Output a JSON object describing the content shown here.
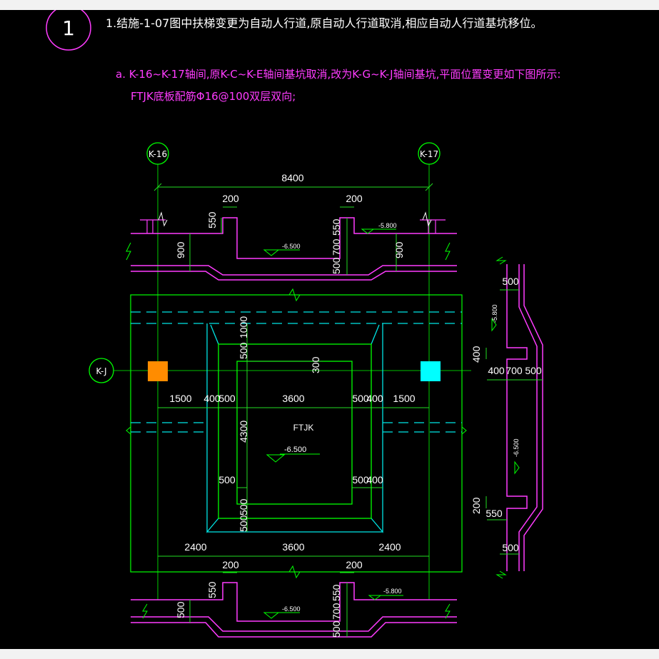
{
  "marker": {
    "number": "1"
  },
  "notes": {
    "main": "1.结施-1-07图中扶梯变更为自动人行道,原自动人行道取消,相应自动人行道基坑移位。",
    "item_a": "a. K-16~K-17轴间,原K-C~K-E轴间基坑取消,改为K-G~K-J轴间基坑,平面位置变更如下图所示:",
    "item_a2": "FTJK底板配筋Φ16@100双层双向;"
  },
  "axes": {
    "left": "K-16",
    "right": "K-17",
    "row": "K-J"
  },
  "plan": {
    "pit_label": "FTJK",
    "pit_level": "-6.500",
    "dim_total": "8400",
    "dims_inner_row": [
      "1500",
      "400",
      "500",
      "3600",
      "500",
      "400",
      "1500"
    ],
    "dims_bottom_row": [
      "2400",
      "3600",
      "2400"
    ],
    "dim_height": "4300",
    "dim_vertical_top": [
      "1000",
      "500",
      "300"
    ],
    "dim_vertical_bottom": [
      "500",
      "500"
    ],
    "dim_inner_small": [
      "500",
      "500",
      "400"
    ]
  },
  "section_top": {
    "dims_horizontal": [
      "200",
      "200"
    ],
    "dims_vertical_left": [
      "550",
      "900"
    ],
    "dims_vertical_mid": [
      "550",
      "700",
      "500"
    ],
    "dims_vertical_right": [
      "900"
    ],
    "level_pit": "-6.500",
    "level_side": "-5.800"
  },
  "section_bottom": {
    "dims_horizontal": [
      "200",
      "200"
    ],
    "dims_vertical_left": [
      "550",
      "500"
    ],
    "dims_vertical_mid": [
      "550",
      "700",
      "500"
    ],
    "level_pit": "-6.500",
    "level_side": "-5.800"
  },
  "section_side": {
    "dims_top": [
      "500"
    ],
    "dims_mid": [
      "400",
      "400",
      "700",
      "500"
    ],
    "dims_lower": [
      "200",
      "550"
    ],
    "dims_bottom": [
      "500"
    ],
    "level_top": "-5.800",
    "level_mid": "-6.500"
  },
  "colors": {
    "background": "#000000",
    "structure_green": "#00ff00",
    "section_magenta": "#ff3cff",
    "hidden_cyan": "#00e5e5",
    "dimension_green": "#22dd22",
    "text_white": "#ffffff",
    "column_orange": "#ff8c00",
    "column_cyan": "#00ffff"
  }
}
